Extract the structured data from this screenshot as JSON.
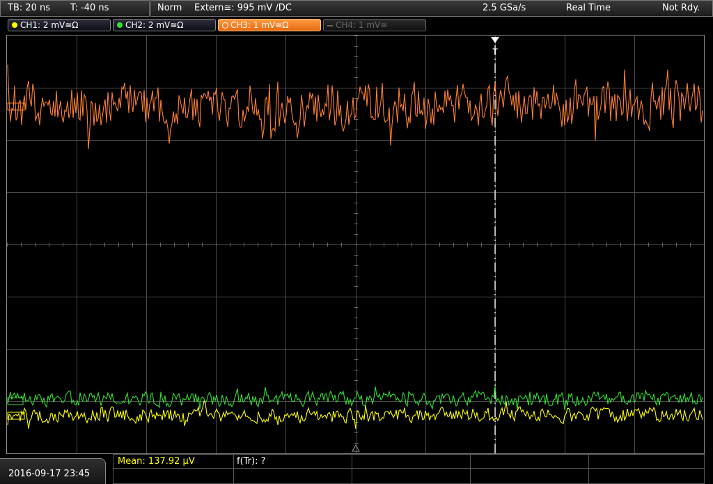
{
  "topbar": {
    "tb_label": "TB: 20 ns",
    "trig_pos": "T: -40 ns",
    "mode": "Norm",
    "trigger_source": "Extern≅: 995 mV ∕DC",
    "sample_rate": "2.5 GSa/s",
    "acq_mode": "Real Time",
    "status": "Not Rdy."
  },
  "channels": [
    {
      "label": "CH1: 2 mV≅Ω",
      "color": "#ffff00",
      "active": true
    },
    {
      "label": "CH2: 2 mV≅Ω",
      "color": "#33dd33",
      "active": true
    },
    {
      "label": "CH3: 1 mV≅Ω",
      "color": "#ff8020",
      "active": true,
      "selected": true
    },
    {
      "label": "CH4: 1 mV≅",
      "color": "#666666",
      "active": false
    }
  ],
  "colors": {
    "ch1": "#ffff00",
    "ch2": "#33dd33",
    "ch3": "#ff8030",
    "grid": "#4a4a4a",
    "trigger_marker": "#ffffff"
  },
  "markers": {
    "trigger": "T"
  },
  "bottom": {
    "datetime": "2016-09-17 23:45",
    "meas1": "Mean: 137.92 µV",
    "meas2": "f(Tr): ?"
  }
}
